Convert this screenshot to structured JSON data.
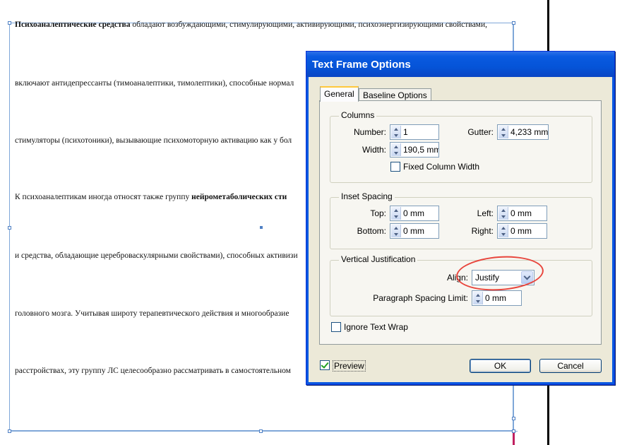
{
  "document": {
    "lines": [
      {
        "bold": "Психоаналептические средства",
        "rest": " обладают возбуждающими, стимулирующими, активирующими, психоэнергизирующими свойствами,"
      },
      {
        "bold": "",
        "rest": "включают антидепрессанты (тимоаналептики, тимолептики), способные нормал"
      },
      {
        "bold": "",
        "rest": "стимуляторы (психотоники), вызывающие психомоторную активацию как у бол"
      },
      {
        "pre": "К психоаналептикам иногда относят также группу ",
        "bold": "нейрометаболических сти",
        "rest": ""
      },
      {
        "bold": "",
        "rest": "и средства, обладающие цереброваскулярными свойствами), способных активизи"
      },
      {
        "bold": "",
        "rest": "головного мозга. Учитывая широту терапевтического действия и многообразие"
      },
      {
        "bold": "",
        "rest": "расстройствах, эту группу ЛС целесообразно рассматривать в самостоятельном"
      }
    ]
  },
  "dialog": {
    "title": "Text Frame Options",
    "tabs": [
      "General",
      "Baseline Options"
    ],
    "columns": {
      "title": "Columns",
      "number_label": "Number:",
      "number_value": "1",
      "width_label": "Width:",
      "width_value": "190,5 mm",
      "gutter_label": "Gutter:",
      "gutter_value": "4,233 mm",
      "fixed_label": "Fixed Column Width"
    },
    "inset": {
      "title": "Inset Spacing",
      "top_label": "Top:",
      "top_value": "0 mm",
      "bottom_label": "Bottom:",
      "bottom_value": "0 mm",
      "left_label": "Left:",
      "left_value": "0 mm",
      "right_label": "Right:",
      "right_value": "0 mm"
    },
    "vj": {
      "title": "Vertical Justification",
      "align_label": "Align:",
      "align_value": "Justify",
      "psl_label": "Paragraph Spacing Limit:",
      "psl_value": "0 mm"
    },
    "ignore_wrap_label": "Ignore Text Wrap",
    "preview_label": "Preview",
    "ok_label": "OK",
    "cancel_label": "Cancel"
  }
}
